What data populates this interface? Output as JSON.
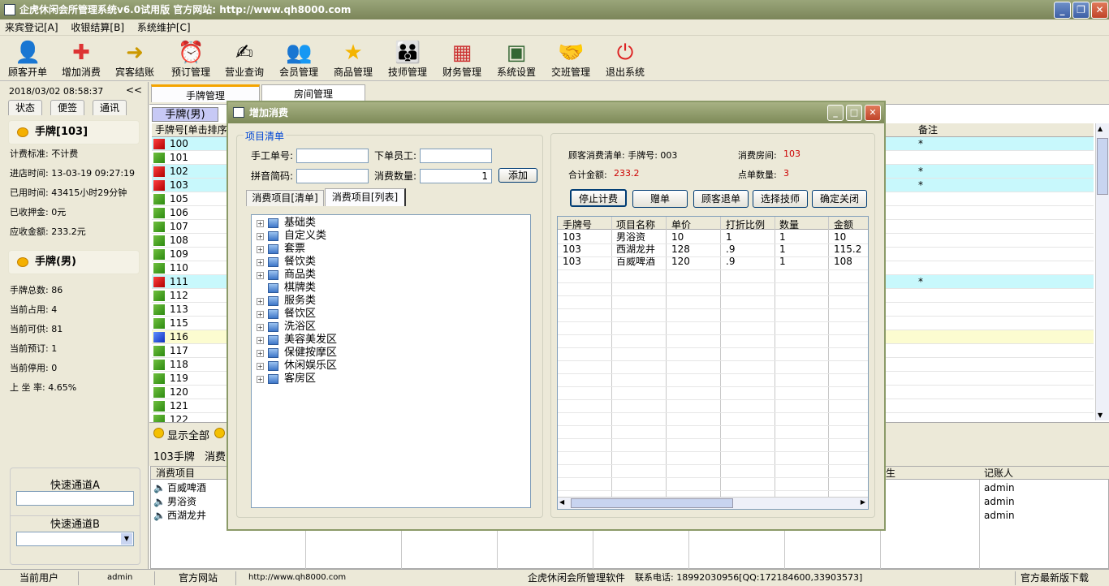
{
  "app": {
    "title": "企虎休闲会所管理系统v6.0试用版   官方网站: http://www.qh8000.com",
    "window_controls": {
      "minimize": "_",
      "maximize": "❐",
      "close": "✕"
    }
  },
  "menu": [
    "来宾登记[A]",
    "收银结算[B]",
    "系统维护[C]"
  ],
  "toolbar": [
    {
      "label": "顾客开单",
      "icon": "customer-icon"
    },
    {
      "label": "增加消费",
      "icon": "add-consumption-icon"
    },
    {
      "label": "宾客结账",
      "icon": "checkout-icon"
    },
    {
      "label": "预订管理",
      "icon": "alarm-clock-icon"
    },
    {
      "label": "营业查询",
      "icon": "query-icon"
    },
    {
      "label": "会员管理",
      "icon": "members-icon"
    },
    {
      "label": "商品管理",
      "icon": "star-icon"
    },
    {
      "label": "技师管理",
      "icon": "technician-icon"
    },
    {
      "label": "财务管理",
      "icon": "finance-icon"
    },
    {
      "label": "系统设置",
      "icon": "settings-icon"
    },
    {
      "label": "交班管理",
      "icon": "handshake-icon"
    },
    {
      "label": "退出系统",
      "icon": "power-icon"
    }
  ],
  "left": {
    "datetime": "2018/03/02 08:58:37",
    "collapse": "<<",
    "tabs": [
      "状态",
      "便签",
      "通讯"
    ],
    "card1": {
      "title": "手牌[103]",
      "rows": [
        "计费标准: 不计费",
        "进店时间: 13-03-19 09:27:19",
        "已用时间: 43415小时29分钟",
        "已收押金: 0元",
        "应收金额: 233.2元"
      ]
    },
    "card2": {
      "title": "手牌(男)",
      "rows": [
        "手牌总数: 86",
        "当前占用: 4",
        "当前可供: 81",
        "当前预订: 1",
        "当前停用: 0",
        "上 坐 率: 4.65%"
      ]
    },
    "quick_a": "快速通道A",
    "quick_b": "快速通道B",
    "dropdown_arrow": "▼"
  },
  "main": {
    "tabs": [
      "手牌管理",
      "房间管理"
    ],
    "subtab": "手牌(男)",
    "header_col1": "手牌号[单击排序]",
    "header_note": "备注",
    "rows": [
      {
        "num": "100",
        "flag": "red",
        "note": "*"
      },
      {
        "num": "101",
        "flag": "green",
        "note": ""
      },
      {
        "num": "102",
        "flag": "red",
        "note": "*"
      },
      {
        "num": "103",
        "flag": "red",
        "note": "*"
      },
      {
        "num": "105",
        "flag": "green",
        "note": ""
      },
      {
        "num": "106",
        "flag": "green",
        "note": ""
      },
      {
        "num": "107",
        "flag": "green",
        "note": ""
      },
      {
        "num": "108",
        "flag": "green",
        "note": ""
      },
      {
        "num": "109",
        "flag": "green",
        "note": ""
      },
      {
        "num": "110",
        "flag": "green",
        "note": ""
      },
      {
        "num": "111",
        "flag": "red",
        "note": "*"
      },
      {
        "num": "112",
        "flag": "green",
        "note": ""
      },
      {
        "num": "113",
        "flag": "green",
        "note": ""
      },
      {
        "num": "115",
        "flag": "green",
        "note": ""
      },
      {
        "num": "116",
        "flag": "blue",
        "note": ""
      },
      {
        "num": "117",
        "flag": "green",
        "note": ""
      },
      {
        "num": "118",
        "flag": "green",
        "note": ""
      },
      {
        "num": "119",
        "flag": "green",
        "note": ""
      },
      {
        "num": "120",
        "flag": "green",
        "note": ""
      },
      {
        "num": "121",
        "flag": "green",
        "note": ""
      },
      {
        "num": "122",
        "flag": "green",
        "note": ""
      }
    ],
    "show_all": "显示全部",
    "detail_label": "103手牌",
    "detail_label2": "消费",
    "lower_header": {
      "item": "消费项目",
      "col2": "生",
      "recorder": "记账人"
    },
    "lower_rows": [
      {
        "item": "百威啤酒",
        "recorder": "admin"
      },
      {
        "item": "男浴资",
        "recorder": "admin"
      },
      {
        "item": "西湖龙井",
        "recorder": "admin"
      }
    ]
  },
  "dialog": {
    "title": "增加消费",
    "group_title": "项目清单",
    "labels": {
      "manual_no": "手工单号:",
      "staff": "下单员工:",
      "pinyin": "拼音简码:",
      "qty": "消费数量:"
    },
    "qty_value": "1",
    "add_button": "添加",
    "tabs": [
      "消费项目[清单]",
      "消费项目[列表]"
    ],
    "tree": [
      "基础类",
      "自定义类",
      "套票",
      "餐饮类",
      "商品类",
      "棋牌类",
      "服务类",
      "餐饮区",
      "洗浴区",
      "美容美发区",
      "保健按摩区",
      "休闲娱乐区",
      "客房区"
    ],
    "summary": {
      "list_label": "顾客消费清单: 手牌号: 003",
      "room_label": "消费房间:",
      "room_value": "103",
      "total_label": "合计金额:",
      "total_value": "233.2",
      "count_label": "点单数量:",
      "count_value": "3"
    },
    "buttons": [
      "停止计费",
      "赠单",
      "顾客退单",
      "选择技师",
      "确定关闭"
    ],
    "columns": [
      "手牌号",
      "项目名称",
      "单价",
      "打折比例",
      "数量",
      "金额"
    ],
    "rows": [
      [
        "103",
        "男浴资",
        "10",
        "1",
        "1",
        "10"
      ],
      [
        "103",
        "西湖龙井",
        "128",
        ".9",
        "1",
        "115.2"
      ],
      [
        "103",
        "百威啤酒",
        "120",
        ".9",
        "1",
        "108"
      ]
    ]
  },
  "status": {
    "user_label": "当前用户",
    "user": "admin",
    "site_label": "官方网站",
    "site": "http://www.qh8000.com",
    "software": "企虎休闲会所管理软件",
    "phone": "联系电话: 18992030956[QQ:172184600,33903573]",
    "download": "官方最新版下载"
  }
}
